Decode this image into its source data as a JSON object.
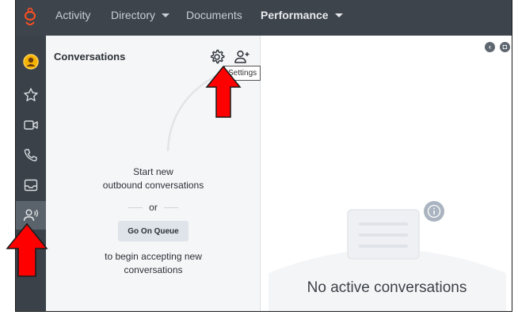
{
  "nav": {
    "items": [
      {
        "label": "Activity",
        "has_caret": false,
        "active": false
      },
      {
        "label": "Directory",
        "has_caret": true,
        "active": false
      },
      {
        "label": "Documents",
        "has_caret": false,
        "active": false
      },
      {
        "label": "Performance",
        "has_caret": true,
        "active": true
      }
    ],
    "logo_icon": "genesys-logo-icon"
  },
  "siderail": {
    "items": [
      {
        "icon": "user-avatar-icon"
      },
      {
        "icon": "star-icon"
      },
      {
        "icon": "video-icon"
      },
      {
        "icon": "phone-icon"
      },
      {
        "icon": "inbox-icon"
      },
      {
        "icon": "agent-voice-icon",
        "selected": true
      }
    ]
  },
  "conversations": {
    "title": "Conversations",
    "settings_icon": "gear-icon",
    "add_participant_icon": "add-person-icon",
    "tooltip": "Settings",
    "start_line1": "Start new",
    "start_line2": "outbound conversations",
    "or": "or",
    "queue_button": "Go On Queue",
    "accept_line1": "to begin accepting new",
    "accept_line2": "conversations"
  },
  "main": {
    "collapse_icon": "chevron-left-icon",
    "popout_icon": "popout-icon",
    "empty_title": "No active conversations",
    "info_icon": "info-icon"
  },
  "colors": {
    "nav_bg": "#3d444c",
    "rail_bg": "#3a4149",
    "panel_bg": "#f5f6f7",
    "accent_orange": "#ff4f1f",
    "arrow_red": "#ff0000"
  }
}
